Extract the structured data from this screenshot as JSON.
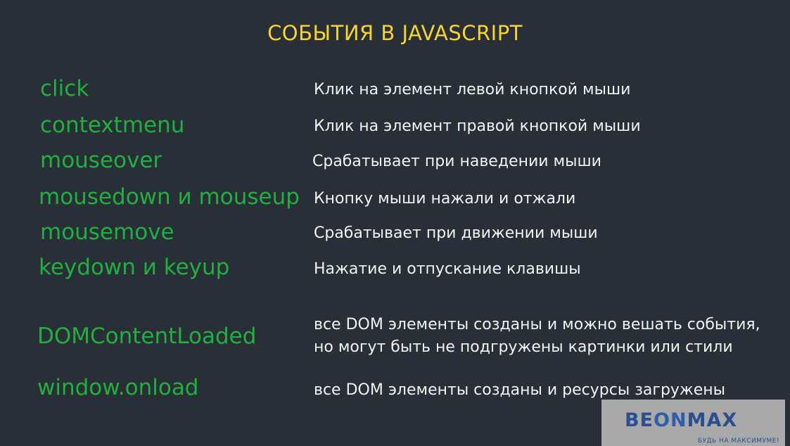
{
  "title": "СОБЫТИЯ В JAVASCRIPT",
  "events": [
    {
      "name": "click",
      "description": "Клик на элемент левой кнопкой мыши"
    },
    {
      "name": "contextmenu",
      "description": "Клик на элемент правой кнопкой мыши"
    },
    {
      "name": "mouseover",
      "description": "Срабатывает при наведении мыши"
    },
    {
      "name": "mousedown и mouseup",
      "description": "Кнопку мыши нажали и отжали"
    },
    {
      "name": "mousemove",
      "description": "Срабатывает при движении мыши"
    },
    {
      "name": "keydown и keyup",
      "description": "Нажатие и отпускание клавишы"
    },
    {
      "name": "DOMContentLoaded",
      "description_line1": "все DOM элементы созданы и можно вешать события,",
      "description_line2": "но могут быть не подгружены картинки или стили"
    },
    {
      "name": "window.onload",
      "description": "все DOM элементы созданы и ресурсы загружены"
    }
  ],
  "logo": {
    "part1": "BE",
    "part2": "ON",
    "part3": "MAX",
    "slogan": "БУДЬ НА МАКСИМУМЕ!"
  },
  "colors": {
    "background": "#2a2e37",
    "title": "#f5d531",
    "event": "#1fb13f",
    "description": "#f2f2f2"
  }
}
